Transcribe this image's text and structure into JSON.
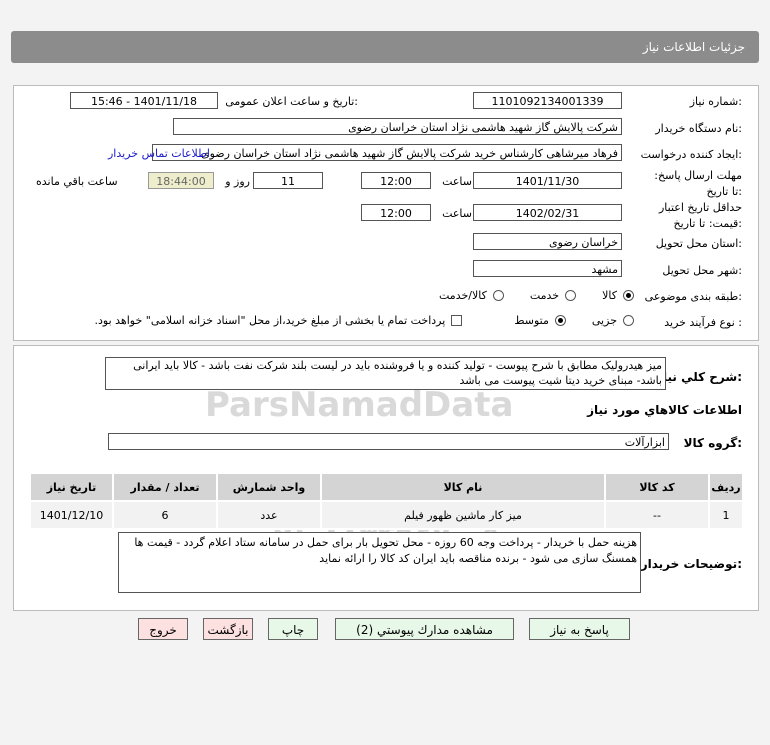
{
  "header": {
    "title": "جزئیات اطلاعات نیاز"
  },
  "form": {
    "need_number_label": "شماره نیاز:",
    "need_number": "1101092134001339",
    "announce_label": "تاریخ و ساعت اعلان عمومی:",
    "announce_value": "1401/11/18 - 15:46",
    "buyer_label": "نام دستگاه خریدار:",
    "buyer_value": "شرکت پالایش گاز شهید هاشمی نژاد   استان خراسان رضوی",
    "creator_label": "ایجاد کننده درخواست:",
    "creator_value": "فرهاد میرشاهی کارشناس خرید شرکت پالایش گاز شهید هاشمی نژاد   استان خراسان رضوی",
    "contact_link": "اطلاعات تماس خریدار",
    "deadline_label": "مهلت ارسال پاسخ: تا تاریخ:",
    "deadline_date": "1401/11/30",
    "time_label": "ساعت",
    "deadline_time": "12:00",
    "days": "11",
    "days_label": "روز و",
    "remaining": "18:44:00",
    "remaining_label": "ساعت باقي مانده",
    "validity_label": "حداقل تاریخ اعتبار قیمت: تا تاریخ:",
    "validity_date": "1402/02/31",
    "validity_time": "12:00",
    "province_label": "استان محل تحویل:",
    "province": "خراسان رضوی",
    "city_label": "شهر محل تحویل:",
    "city": "مشهد",
    "category_label": "طبقه بندی موضوعی:",
    "category_options": [
      "کالا",
      "خدمت",
      "کالا/خدمت"
    ],
    "category_selected": "کالا",
    "process_label": "نوع فرآیند خرید :",
    "process_options": [
      "جزیی",
      "متوسط"
    ],
    "process_selected": "متوسط",
    "payment_note": "پرداخت تمام یا بخشی از مبلغ خرید،از محل \"اسناد خزانه اسلامی\" خواهد بود."
  },
  "details": {
    "desc_label": "شرح کلي نیاز:",
    "desc": "میز هیدرولیک مطابق با شرح پیوست - تولید کننده و یا فروشنده باید در لیست بلند شرکت نفت باشد - کالا باید ایرانی باشد- مبنای خرید دیتا شیت پیوست می باشد",
    "goods_title": "اطلاعات کالاهاي مورد نياز",
    "group_label": "گروه کالا:",
    "group": "ابزارآلات",
    "table": {
      "headers": [
        "ردیف",
        "کد کالا",
        "نام کالا",
        "واحد شمارش",
        "تعداد / مقدار",
        "تاریخ نیاز"
      ],
      "rows": [
        [
          "1",
          "--",
          "میز کار ماشین ظهور فیلم",
          "عدد",
          "6",
          "1401/12/10"
        ]
      ]
    },
    "notes_label": "توضیحات خریدار:",
    "notes": "هزینه حمل با خریدار - پرداخت وجه 60 روزه - محل تحویل بار برای حمل در سامانه ستاد اعلام گردد - قیمت ها همسنگ سازی می شود - برنده مناقصه باید ایران کد کالا را ارائه نماید"
  },
  "buttons": {
    "reply": "پاسخ به نیاز",
    "attachments": "مشاهده مدارك پیوستي (2)",
    "print": "چاپ",
    "back": "بازگشت",
    "exit": "خروج"
  },
  "watermark": {
    "brand": "ParsNamadData",
    "phone": "۰۲۱-۸۸۳۴۹۶۷۰-۵"
  },
  "colors": {
    "header": "#8c8c8c",
    "link": "#1a1acc",
    "remaining_bg": "#eeeecc"
  }
}
